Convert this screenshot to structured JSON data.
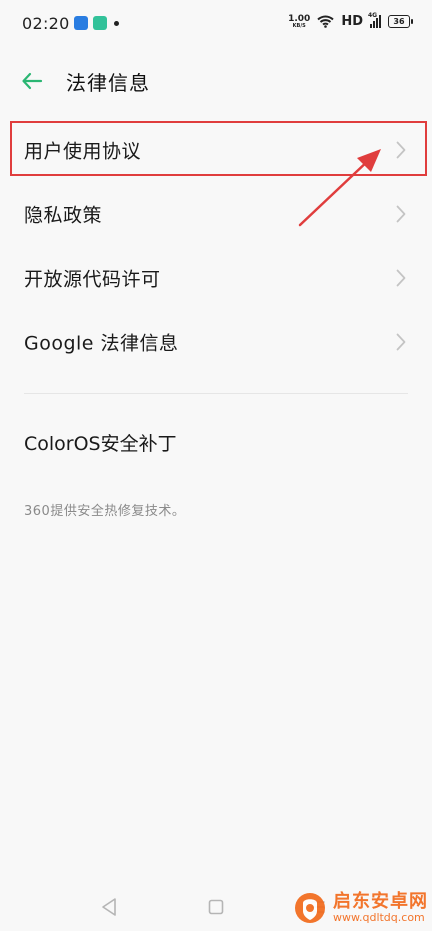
{
  "status_bar": {
    "time": "02:20",
    "speed_value": "1.00",
    "speed_unit": "KB/S",
    "hd": "HD",
    "network": "4G",
    "battery": "36"
  },
  "header": {
    "back_icon": "arrow-left-icon",
    "title": "法律信息",
    "accent_color": "#2bb673"
  },
  "items": [
    {
      "label": "用户使用协议"
    },
    {
      "label": "隐私政策"
    },
    {
      "label": "开放源代码许可"
    },
    {
      "label": "Google 法律信息"
    }
  ],
  "security_patch": {
    "label": "ColorOS安全补丁",
    "subtext": "360提供安全热修复技术。"
  },
  "annotation": {
    "color": "#e03d3d"
  },
  "nav": {
    "back_icon": "triangle-back-icon",
    "home_icon": "square-home-icon",
    "recent_icon": "recent-apps-icon"
  },
  "watermark": {
    "title": "启东安卓网",
    "url": "www.qdltdq.com"
  }
}
